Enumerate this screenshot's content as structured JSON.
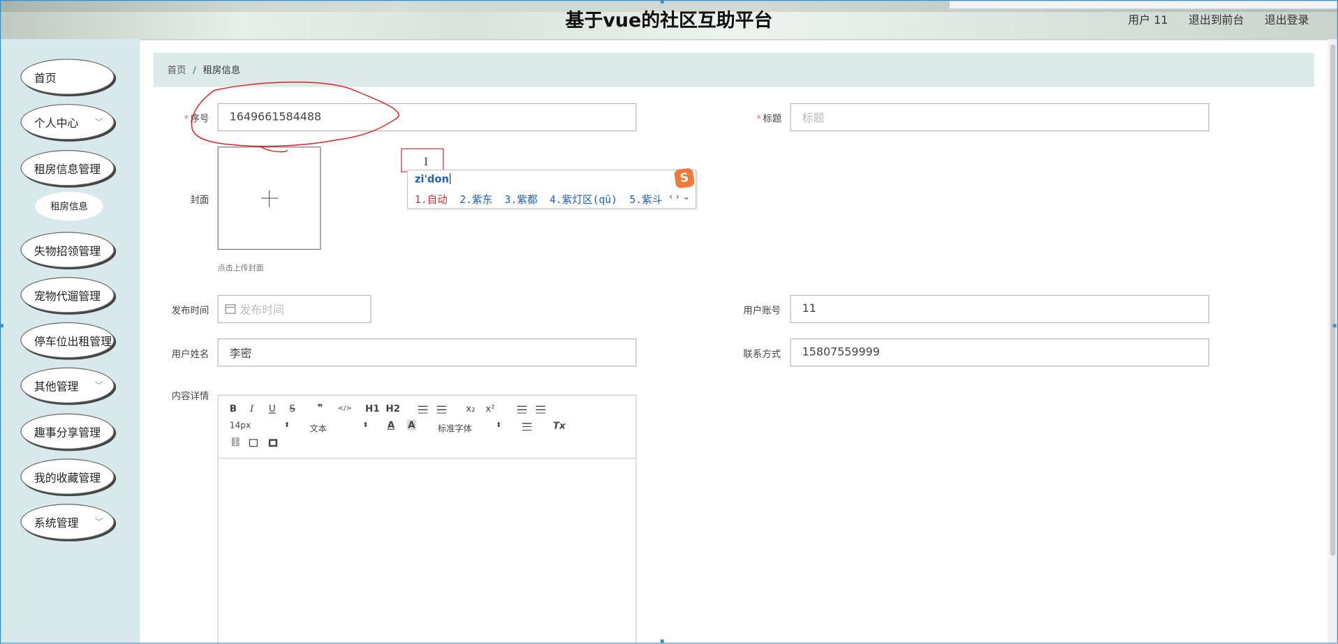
{
  "header": {
    "title": "基于vue的社区互助平台",
    "user_label": "用户 11",
    "back_to_front": "退出到前台",
    "logout": "退出登录"
  },
  "sidebar": {
    "items": [
      {
        "label": "首页"
      },
      {
        "label": "个人中心",
        "chevron": "﹀"
      },
      {
        "label": "租房信息管理"
      },
      {
        "label": "租房信息",
        "sub": true
      },
      {
        "label": "失物招领管理"
      },
      {
        "label": "宠物代遛管理"
      },
      {
        "label": "停车位出租管理"
      },
      {
        "label": "其他管理",
        "chevron": "﹀"
      },
      {
        "label": "趣事分享管理"
      },
      {
        "label": "我的收藏管理"
      },
      {
        "label": "系统管理",
        "chevron": "﹀"
      }
    ]
  },
  "breadcrumb": {
    "home": "首页",
    "separator": "/",
    "current": "租房信息"
  },
  "form": {
    "required_mark": "*",
    "serial_label": "序号",
    "serial_value": "1649661584488",
    "title_label": "标题",
    "title_placeholder": "标题",
    "cover_label": "封面",
    "cover_tip": "点击上传封面",
    "publish_time_label": "发布时间",
    "publish_time_placeholder": "发布时间",
    "account_label": "用户账号",
    "account_value": "11",
    "name_label": "用户姓名",
    "name_value": "李密",
    "contact_label": "联系方式",
    "contact_value": "15807559999",
    "content_label": "内容详情"
  },
  "editor": {
    "bold": "B",
    "italic": "I",
    "underline": "U",
    "strike": "S",
    "blockquote": "❞",
    "code": "</>",
    "h1": "H1",
    "h2": "H2",
    "subscript": "x₂",
    "superscript": "x²",
    "size_select": "14px",
    "header_select": "文本",
    "font_select": "标准字体",
    "clean": "Tx"
  },
  "ime": {
    "input": "zi'don",
    "candidates": [
      "1.自动",
      "2.紫东",
      "3.紫都",
      "4.紫灯区(qū)",
      "5.紫斗"
    ],
    "nav": "‹ › ⌄",
    "logo": "S",
    "caret": "I"
  },
  "colors": {
    "sidebar_bg": "#d7e9ea",
    "breadcrumb_bg": "#dcebe9",
    "required": "#f56c6c",
    "ime_blue": "#1f5fb5",
    "ime_red": "#c83333",
    "annotation_red": "#e02020"
  }
}
